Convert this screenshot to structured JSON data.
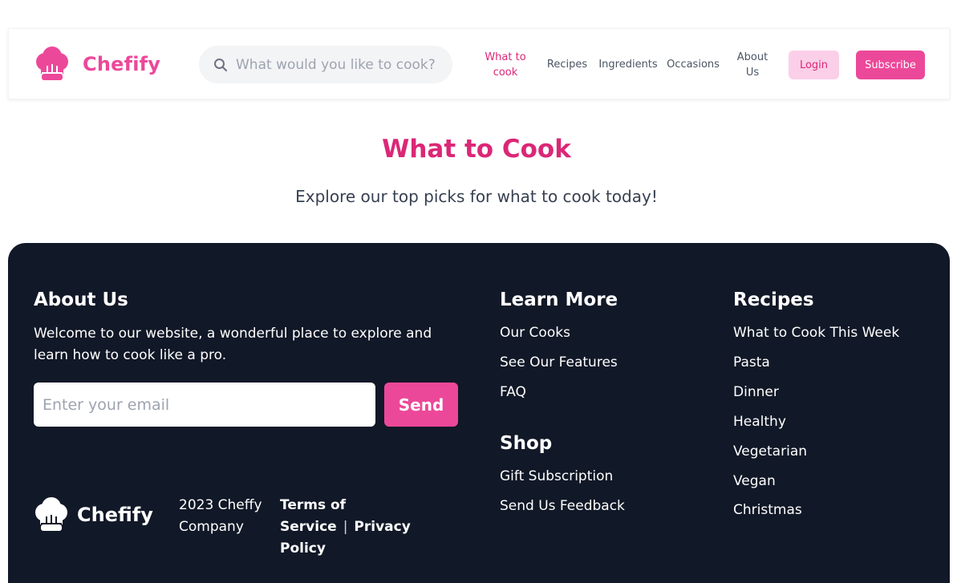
{
  "brand": {
    "name": "Chefify",
    "accent": "#ec4899",
    "accent_dark": "#db2777"
  },
  "search": {
    "placeholder": "What would you like to cook?"
  },
  "nav": {
    "items": [
      {
        "label_line1": "What to",
        "label_line2": "cook",
        "active": true
      },
      {
        "label": "Recipes"
      },
      {
        "label": "Ingredients"
      },
      {
        "label": "Occasions"
      },
      {
        "label_line1": "About",
        "label_line2": "Us"
      }
    ],
    "login_label": "Login",
    "subscribe_label": "Subscribe"
  },
  "hero": {
    "title": "What to Cook",
    "subtitle": "Explore our top picks for what to cook today!"
  },
  "footer": {
    "bg": "#111827",
    "about": {
      "heading": "About Us",
      "text": "Welcome to our website, a wonderful place to explore and learn how to cook like a pro.",
      "email_placeholder": "Enter your email",
      "send_label": "Send"
    },
    "learn_more": {
      "heading": "Learn More",
      "links": [
        "Our Cooks",
        "See Our Features",
        "FAQ"
      ]
    },
    "shop": {
      "heading": "Shop",
      "links": [
        "Gift Subscription",
        "Send Us Feedback"
      ]
    },
    "recipes": {
      "heading": "Recipes",
      "links": [
        "What to Cook This Week",
        "Pasta",
        "Dinner",
        "Healthy",
        "Vegetarian",
        "Vegan",
        "Christmas"
      ]
    },
    "brand_name": "Chefify",
    "copyright_line1": "2023 Cheffy",
    "copyright_line2": "Company",
    "terms_label": "Terms of Service",
    "separator": "|",
    "privacy_line1": "Privacy",
    "privacy_line2": "Policy"
  },
  "icons": [
    "chef-hat-icon",
    "search-icon"
  ]
}
